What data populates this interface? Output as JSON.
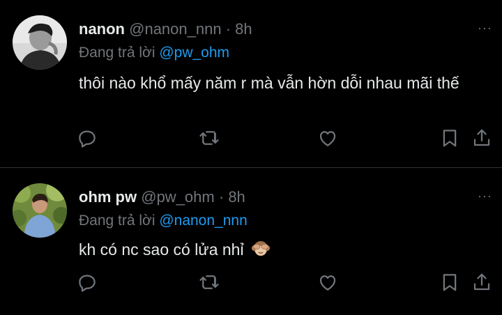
{
  "tweets": [
    {
      "name": "nanon",
      "handle": "@nanon_nnn",
      "dot": "·",
      "time": "8h",
      "reply_prefix": "Đang trả lời ",
      "reply_to": "@pw_ohm",
      "text": "thôi nào khổ mấy năm r mà vẫn hờn dỗi nhau mãi thế",
      "more": "···",
      "avatar_style": "grayscale"
    },
    {
      "name": "ohm pw",
      "handle": "@pw_ohm",
      "dot": "·",
      "time": "8h",
      "reply_prefix": "Đang trả lời ",
      "reply_to": "@nanon_nnn",
      "text": "kh có nc sao có lửa nhỉ",
      "emoji": "see-no-evil-monkey",
      "more": "···",
      "avatar_style": "outdoor-photo"
    }
  ],
  "actions": [
    "reply-icon",
    "retweet-icon",
    "like-icon",
    "bookmark-icon",
    "share-icon"
  ],
  "colors": {
    "background": "#000000",
    "text": "#e7e9ea",
    "muted": "#71767b",
    "accent": "#1d9bf0",
    "divider": "#2f3336"
  }
}
